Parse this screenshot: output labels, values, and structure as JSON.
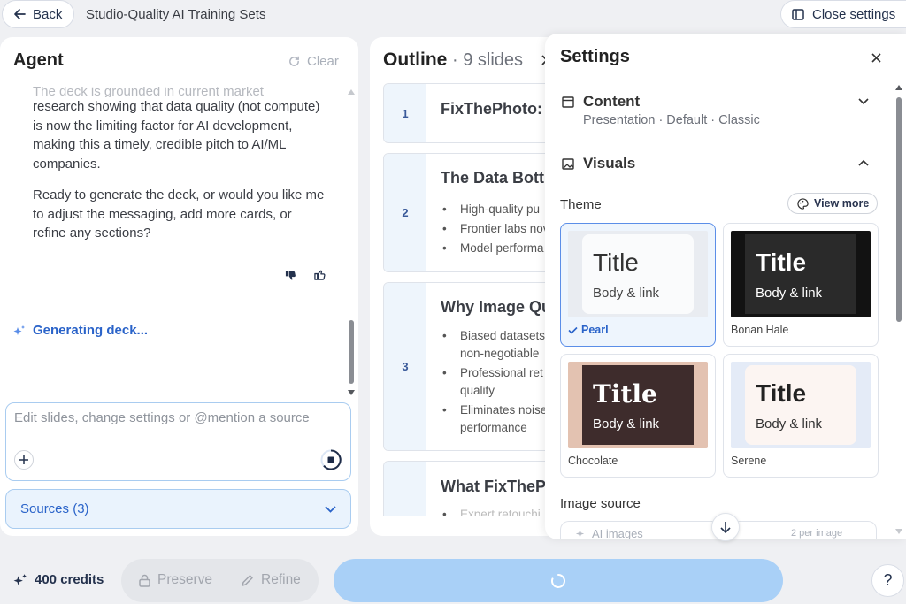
{
  "header": {
    "back_label": "Back",
    "title": "Studio-Quality AI Training Sets",
    "close_settings_label": "Close settings"
  },
  "agent": {
    "title": "Agent",
    "clear_label": "Clear",
    "paragraph1_faded": "The deck is grounded in current market",
    "paragraph1": "research showing that data quality (not compute) is now the limiting factor for AI development, making this a timely, credible pitch to AI/ML companies.",
    "paragraph2": "Ready to generate the deck, or would you like me to adjust the messaging, add more cards, or refine any sections?",
    "generating_label": "Generating deck...",
    "input_placeholder": "Edit slides, change settings or @mention a source",
    "sources_label": "Sources (3)"
  },
  "outline": {
    "title": "Outline",
    "count": "· 9 slides",
    "slides": [
      {
        "num": "1",
        "title": "FixThePhoto:",
        "bullets": []
      },
      {
        "num": "2",
        "title": "The Data Bott",
        "bullets": [
          "High-quality pu",
          "Frontier labs nov",
          "Model performa"
        ]
      },
      {
        "num": "3",
        "title": "Why Image Qu",
        "bullets": [
          "Biased datasets non-negotiable",
          "Professional ret quality",
          "Eliminates noise performance"
        ]
      },
      {
        "num": "",
        "title": "What FixTheP",
        "bullets": [
          "Expert retouchi"
        ]
      }
    ]
  },
  "settings": {
    "title": "Settings",
    "content_label": "Content",
    "content_sub": "Presentation · Default · Classic",
    "visuals_label": "Visuals",
    "theme_label": "Theme",
    "view_more_label": "View more",
    "themes": [
      {
        "name": "Pearl",
        "title": "Title",
        "body": "Body & link",
        "selected": true
      },
      {
        "name": "Bonan Hale",
        "title": "Title",
        "body": "Body & link",
        "selected": false
      },
      {
        "name": "Chocolate",
        "title": "Title",
        "body": "Body & link",
        "selected": false
      },
      {
        "name": "Serene",
        "title": "Title",
        "body": "Body & link",
        "selected": false
      }
    ],
    "image_source_label": "Image source",
    "image_source_value": "AI images",
    "per_image_label": "2 per image"
  },
  "footer": {
    "credits_label": "400 credits",
    "preserve_label": "Preserve",
    "refine_label": "Refine",
    "help_label": "?"
  },
  "colors": {
    "accent": "#2a63c9",
    "selected_border": "#5b8ee8",
    "generate_button": "#a9d0f7",
    "sources_bg": "#eaf3fd"
  }
}
